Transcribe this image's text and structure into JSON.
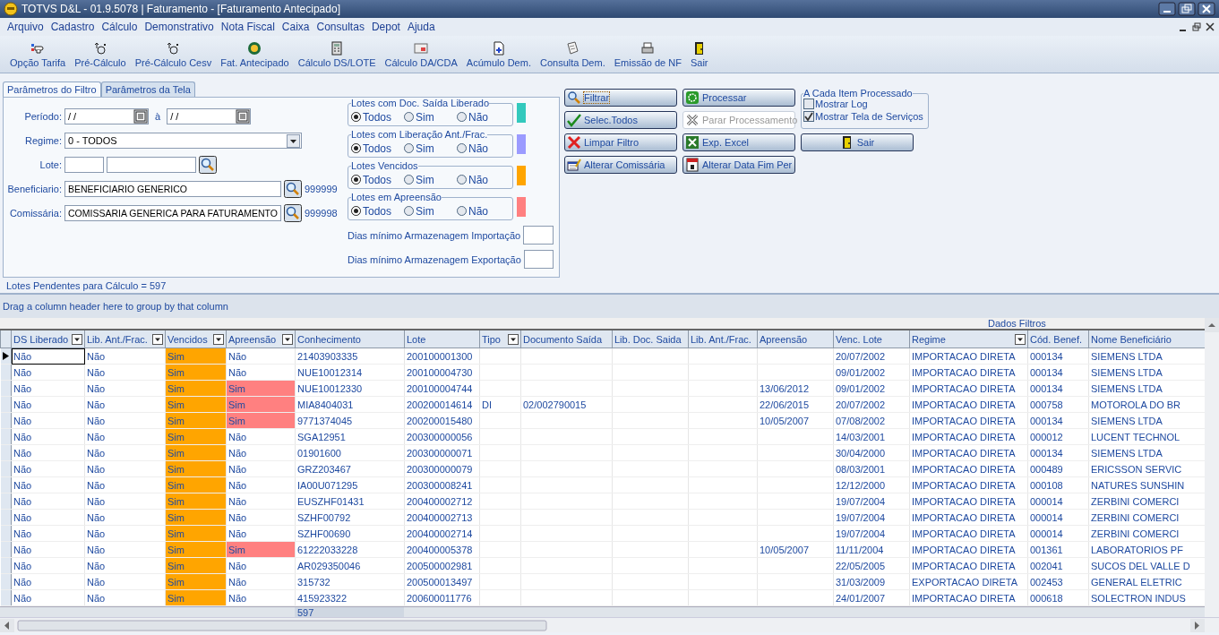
{
  "window": {
    "title": "TOTVS D&L - 01.9.5078 | Faturamento - [Faturamento Antecipado]"
  },
  "menu": [
    "Arquivo",
    "Cadastro",
    "Cálculo",
    "Demonstrativo",
    "Nota Fiscal",
    "Caixa",
    "Consultas",
    "Depot",
    "Ajuda"
  ],
  "toolbar": [
    "Opção Tarifa",
    "Pré-Cálculo",
    "Pré-Cálculo Cesv",
    "Fat. Antecipado",
    "Cálculo DS/LOTE",
    "Cálculo DA/CDA",
    "Acúmulo Dem.",
    "Consulta Dem.",
    "Emissão de NF",
    "Sair"
  ],
  "tabs": [
    {
      "label": "Parâmetros do Filtro",
      "selected": true
    },
    {
      "label": "Parâmetros da Tela",
      "selected": false
    }
  ],
  "form": {
    "periodo": {
      "label": "Período:",
      "from": "/ /",
      "separator": "à",
      "to": "/ /"
    },
    "regime": {
      "label": "Regime:",
      "value": "0 - TODOS"
    },
    "lote": {
      "label": "Lote:"
    },
    "beneficiario": {
      "label": "Beneficiario:",
      "value": "BENEFICIARIO GENERICO",
      "code": "999999"
    },
    "comissaria": {
      "label": "Comissária:",
      "value": "COMISSARIA GENERICA PARA FATURAMENTO",
      "code": "999998"
    }
  },
  "filters": [
    {
      "title": "Lotes com Doc. Saída Liberado",
      "color": "#33c9bd",
      "options": [
        {
          "label": "Todos",
          "selected": true
        },
        {
          "label": "Sim",
          "selected": false
        },
        {
          "label": "Não",
          "selected": false
        }
      ]
    },
    {
      "title": "Lotes com Liberação Ant./Frac.",
      "color": "#9b9bff",
      "options": [
        {
          "label": "Todos",
          "selected": true
        },
        {
          "label": "Sim",
          "selected": false
        },
        {
          "label": "Não",
          "selected": false
        }
      ]
    },
    {
      "title": "Lotes Vencidos",
      "color": "#ffa500",
      "options": [
        {
          "label": "Todos",
          "selected": true
        },
        {
          "label": "Sim",
          "selected": false
        },
        {
          "label": "Não",
          "selected": false
        }
      ]
    },
    {
      "title": "Lotes em Apreensão",
      "color": "#ff8080",
      "options": [
        {
          "label": "Todos",
          "selected": true
        },
        {
          "label": "Sim",
          "selected": false
        },
        {
          "label": "Não",
          "selected": false
        }
      ]
    }
  ],
  "min_days": [
    {
      "label": "Dias mínimo Armazenagem Importação"
    },
    {
      "label": "Dias mínimo Armazenagem Exportação"
    }
  ],
  "buttons": [
    {
      "label": "Filtrar",
      "focused": true,
      "disabled": false
    },
    {
      "label": "Processar",
      "focused": false,
      "disabled": false
    },
    {
      "label": "Selec.Todos",
      "focused": false,
      "disabled": false
    },
    {
      "label": "Parar Processamento",
      "focused": false,
      "disabled": true
    },
    {
      "label": "Limpar Filtro",
      "focused": false,
      "disabled": false
    },
    {
      "label": "Exp. Excel",
      "focused": false,
      "disabled": false
    },
    {
      "label": "Sair",
      "focused": false,
      "disabled": false
    },
    {
      "label": "Alterar Comissária",
      "focused": false,
      "disabled": false
    },
    {
      "label": "Alterar Data Fim Per",
      "focused": false,
      "disabled": false
    }
  ],
  "process_options": {
    "title": "A Cada Item Processado",
    "items": [
      {
        "label": "Mostrar Log",
        "checked": false
      },
      {
        "label": "Mostrar Tela de Serviços",
        "checked": true
      }
    ]
  },
  "pending": "Lotes Pendentes para Cálculo = 597",
  "grid": {
    "group_hint": "Drag a column header here to group by that column",
    "band": "Dados Filtros",
    "columns": [
      {
        "label": "DS Liberado",
        "filter": true
      },
      {
        "label": "Lib. Ant./Frac.",
        "filter": true
      },
      {
        "label": "Vencidos",
        "filter": true
      },
      {
        "label": "Apreensão",
        "filter": true
      },
      {
        "label": "Conhecimento",
        "filter": false
      },
      {
        "label": "Lote",
        "filter": false
      },
      {
        "label": "Tipo",
        "filter": true
      },
      {
        "label": "Documento Saída",
        "filter": false
      },
      {
        "label": "Lib. Doc. Saida",
        "filter": false
      },
      {
        "label": "Lib. Ant./Frac.",
        "filter": false
      },
      {
        "label": "Apreensão",
        "filter": false
      },
      {
        "label": "Venc. Lote",
        "filter": false
      },
      {
        "label": "Regime",
        "filter": true
      },
      {
        "label": "Cód. Benef.",
        "filter": false
      },
      {
        "label": "Nome Beneficiário",
        "filter": false
      }
    ],
    "rows": [
      {
        "selected": true,
        "overdue": true,
        "seized": false,
        "cells": [
          "Não",
          "Não",
          "Sim",
          "Não",
          "21403903335",
          "200100001300",
          null,
          null,
          null,
          null,
          null,
          "20/07/2002",
          "IMPORTACAO DIRETA",
          "000134",
          "SIEMENS LTDA"
        ]
      },
      {
        "selected": false,
        "overdue": true,
        "seized": false,
        "cells": [
          "Não",
          "Não",
          "Sim",
          "Não",
          "NUE10012314",
          "200100004730",
          null,
          null,
          null,
          null,
          null,
          "09/01/2002",
          "IMPORTACAO DIRETA",
          "000134",
          "SIEMENS LTDA"
        ]
      },
      {
        "selected": false,
        "overdue": true,
        "seized": true,
        "cells": [
          "Não",
          "Não",
          "Sim",
          "Sim",
          "NUE10012330",
          "200100004744",
          null,
          null,
          null,
          null,
          "13/06/2012",
          "09/01/2002",
          "IMPORTACAO DIRETA",
          "000134",
          "SIEMENS LTDA"
        ]
      },
      {
        "selected": false,
        "overdue": true,
        "seized": true,
        "cells": [
          "Não",
          "Não",
          "Sim",
          "Sim",
          "MIA8404031",
          "200200014614",
          "DI",
          "02/002790015",
          null,
          null,
          "22/06/2015",
          "20/07/2002",
          "IMPORTACAO DIRETA",
          "000758",
          "MOTOROLA DO BR"
        ]
      },
      {
        "selected": false,
        "overdue": true,
        "seized": true,
        "cells": [
          "Não",
          "Não",
          "Sim",
          "Sim",
          "9771374045",
          "200200015480",
          null,
          null,
          null,
          null,
          "10/05/2007",
          "07/08/2002",
          "IMPORTACAO DIRETA",
          "000134",
          "SIEMENS LTDA"
        ]
      },
      {
        "selected": false,
        "overdue": true,
        "seized": false,
        "cells": [
          "Não",
          "Não",
          "Sim",
          "Não",
          "SGA12951",
          "200300000056",
          null,
          null,
          null,
          null,
          null,
          "14/03/2001",
          "IMPORTACAO DIRETA",
          "000012",
          "LUCENT TECHNOL"
        ]
      },
      {
        "selected": false,
        "overdue": true,
        "seized": false,
        "cells": [
          "Não",
          "Não",
          "Sim",
          "Não",
          "01901600",
          "200300000071",
          null,
          null,
          null,
          null,
          null,
          "30/04/2000",
          "IMPORTACAO DIRETA",
          "000134",
          "SIEMENS LTDA"
        ]
      },
      {
        "selected": false,
        "overdue": true,
        "seized": false,
        "cells": [
          "Não",
          "Não",
          "Sim",
          "Não",
          "GRZ203467",
          "200300000079",
          null,
          null,
          null,
          null,
          null,
          "08/03/2001",
          "IMPORTACAO DIRETA",
          "000489",
          "ERICSSON SERVIC"
        ]
      },
      {
        "selected": false,
        "overdue": true,
        "seized": false,
        "cells": [
          "Não",
          "Não",
          "Sim",
          "Não",
          "IA00U071295",
          "200300008241",
          null,
          null,
          null,
          null,
          null,
          "12/12/2000",
          "IMPORTACAO DIRETA",
          "000108",
          "NATURES SUNSHIN"
        ]
      },
      {
        "selected": false,
        "overdue": true,
        "seized": false,
        "cells": [
          "Não",
          "Não",
          "Sim",
          "Não",
          "EUSZHF01431",
          "200400002712",
          null,
          null,
          null,
          null,
          null,
          "19/07/2004",
          "IMPORTACAO DIRETA",
          "000014",
          "ZERBINI COMERCI"
        ]
      },
      {
        "selected": false,
        "overdue": true,
        "seized": false,
        "cells": [
          "Não",
          "Não",
          "Sim",
          "Não",
          "SZHF00792",
          "200400002713",
          null,
          null,
          null,
          null,
          null,
          "19/07/2004",
          "IMPORTACAO DIRETA",
          "000014",
          "ZERBINI COMERCI"
        ]
      },
      {
        "selected": false,
        "overdue": true,
        "seized": false,
        "cells": [
          "Não",
          "Não",
          "Sim",
          "Não",
          "SZHF00690",
          "200400002714",
          null,
          null,
          null,
          null,
          null,
          "19/07/2004",
          "IMPORTACAO DIRETA",
          "000014",
          "ZERBINI COMERCI"
        ]
      },
      {
        "selected": false,
        "overdue": true,
        "seized": true,
        "cells": [
          "Não",
          "Não",
          "Sim",
          "Sim",
          "61222033228",
          "200400005378",
          null,
          null,
          null,
          null,
          "10/05/2007",
          "11/11/2004",
          "IMPORTACAO DIRETA",
          "001361",
          "LABORATORIOS PF"
        ]
      },
      {
        "selected": false,
        "overdue": true,
        "seized": false,
        "cells": [
          "Não",
          "Não",
          "Sim",
          "Não",
          "AR029350046",
          "200500002981",
          null,
          null,
          null,
          null,
          null,
          "22/05/2005",
          "IMPORTACAO DIRETA",
          "002041",
          "SUCOS DEL VALLE D"
        ]
      },
      {
        "selected": false,
        "overdue": true,
        "seized": false,
        "cells": [
          "Não",
          "Não",
          "Sim",
          "Não",
          "315732",
          "200500013497",
          null,
          null,
          null,
          null,
          null,
          "31/03/2009",
          "EXPORTACAO DIRETA",
          "002453",
          "GENERAL ELETRIC"
        ]
      },
      {
        "selected": false,
        "overdue": true,
        "seized": false,
        "cells": [
          "Não",
          "Não",
          "Sim",
          "Não",
          "415923322",
          "200600011776",
          null,
          null,
          null,
          null,
          null,
          "24/01/2007",
          "IMPORTACAO DIRETA",
          "000618",
          "SOLECTRON INDUS"
        ]
      }
    ],
    "footer": "597"
  }
}
